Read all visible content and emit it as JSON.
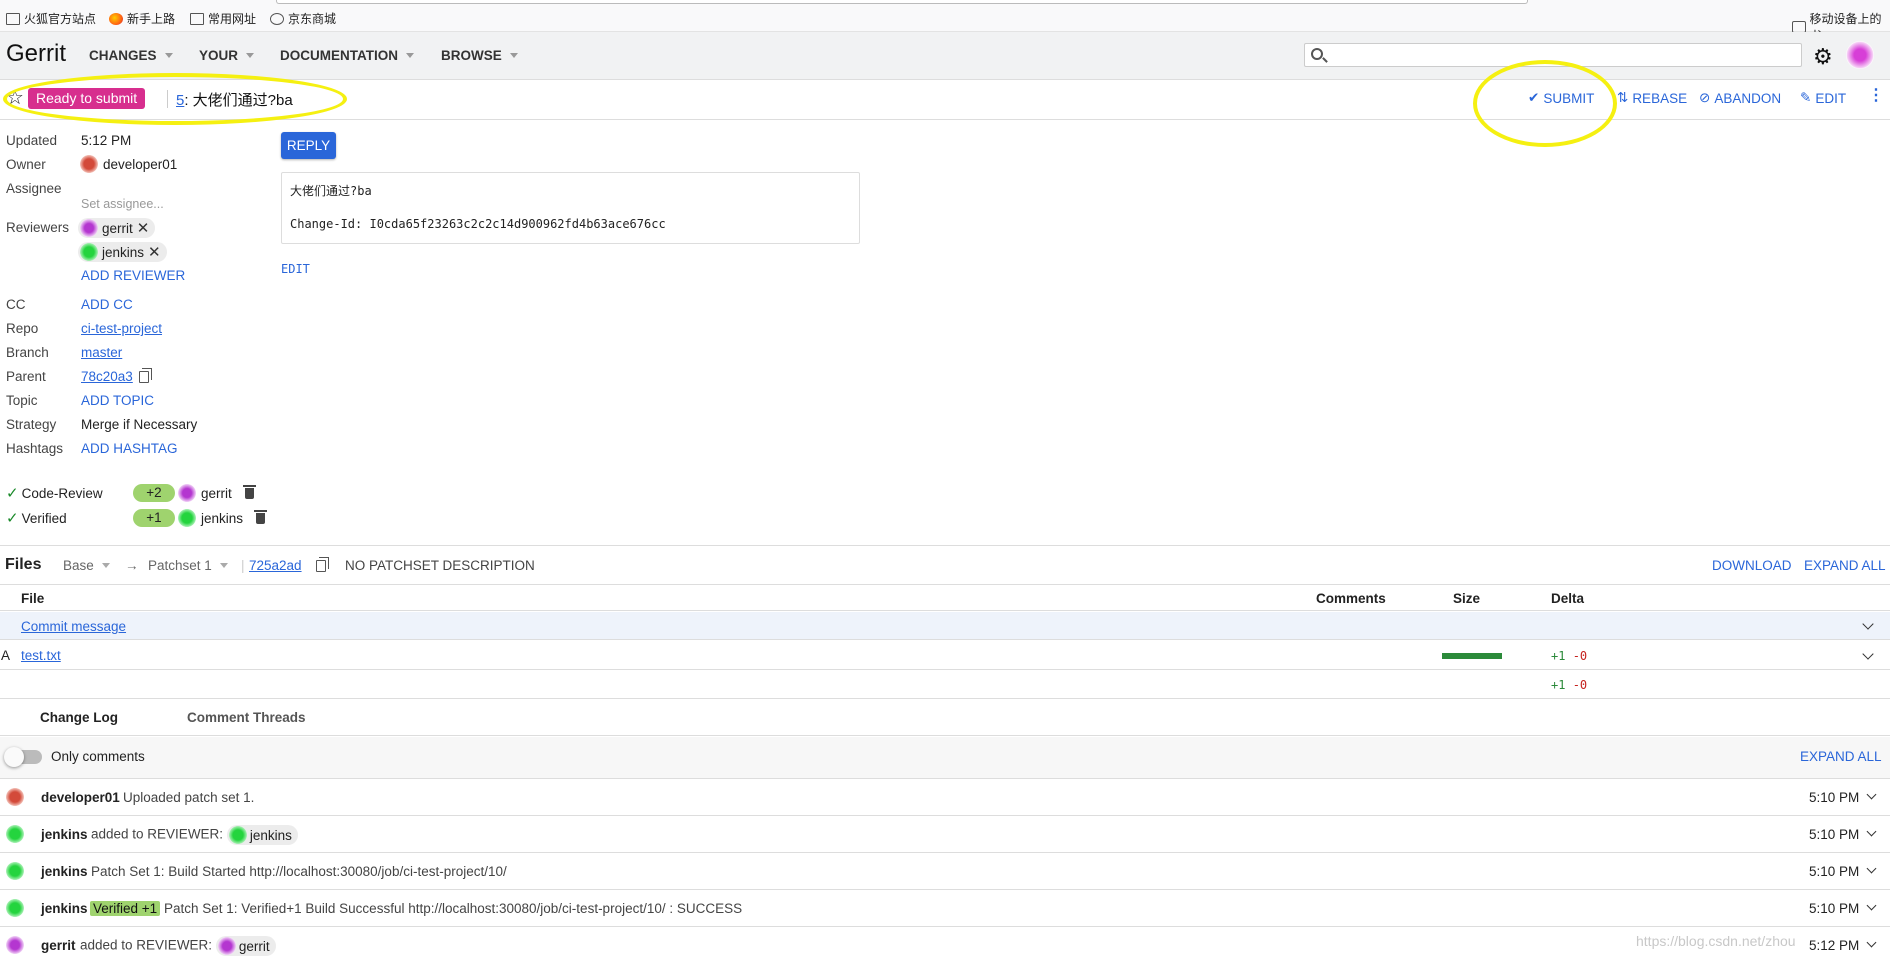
{
  "bookmarks": [
    "火狐官方站点",
    "新手上路",
    "常用网址",
    "京东商城"
  ],
  "bookmarks_right": "移动设备上的书",
  "header": {
    "brand": "Gerrit",
    "menus": [
      "CHANGES",
      "YOUR",
      "DOCUMENTATION",
      "BROWSE"
    ],
    "search_value": ""
  },
  "change": {
    "status": "Ready to submit",
    "number": "5",
    "subject": ": 大佬们通过?ba",
    "actions": [
      "SUBMIT",
      "REBASE",
      "ABANDON",
      "EDIT"
    ]
  },
  "meta": {
    "updated_label": "Updated",
    "updated": "5:12 PM",
    "owner_label": "Owner",
    "owner": "developer01",
    "assignee_label": "Assignee",
    "assignee_placeholder": "Set assignee...",
    "reviewers_label": "Reviewers",
    "reviewers": [
      "gerrit",
      "jenkins"
    ],
    "add_reviewer": "ADD REVIEWER",
    "cc_label": "CC",
    "add_cc": "ADD CC",
    "repo_label": "Repo",
    "repo": "ci-test-project",
    "branch_label": "Branch",
    "branch": "master",
    "parent_label": "Parent",
    "parent": "78c20a3",
    "topic_label": "Topic",
    "add_topic": "ADD TOPIC",
    "strategy_label": "Strategy",
    "strategy": "Merge if Necessary",
    "hashtags_label": "Hashtags",
    "add_hashtag": "ADD HASHTAG"
  },
  "labels": [
    {
      "name": "Code-Review",
      "vote": "+2",
      "voter": "gerrit"
    },
    {
      "name": "Verified",
      "vote": "+1",
      "voter": "jenkins"
    }
  ],
  "commit": {
    "reply": "REPLY",
    "line1": "大佬们通过?ba",
    "line2": "Change-Id: I0cda65f23263c2c2c14d900962fd4b63ace676cc",
    "edit": "EDIT"
  },
  "files": {
    "title": "Files",
    "base": "Base",
    "arrow": "→",
    "patchset": "Patchset 1",
    "commit_hash": "725a2ad",
    "no_desc": "NO PATCHSET DESCRIPTION",
    "download": "DOWNLOAD",
    "expand_all": "EXPAND ALL",
    "columns": [
      "File",
      "Comments",
      "Size",
      "Delta"
    ],
    "rows": [
      {
        "status": "",
        "name": "Commit message"
      },
      {
        "status": "A",
        "name": "test.txt",
        "plus": "+1",
        "minus": "-0",
        "size_fraction": 1.0
      }
    ],
    "total_plus": "+1",
    "total_minus": "-0"
  },
  "tabs": [
    "Change Log",
    "Comment Threads"
  ],
  "only_comments": "Only comments",
  "log_expand_all": "EXPAND ALL",
  "messages": [
    {
      "author": "developer01",
      "text": "Uploaded patch set 1.",
      "time": "5:10 PM"
    },
    {
      "author": "jenkins",
      "text": "added to REVIEWER:",
      "chip": "jenkins",
      "time": "5:10 PM"
    },
    {
      "author": "jenkins",
      "text": "Patch Set 1: Build Started http://localhost:30080/job/ci-test-project/10/",
      "time": "5:10 PM"
    },
    {
      "author": "jenkins",
      "vote_chip": "Verified +1",
      "text": "Patch Set 1: Verified+1 Build Successful http://localhost:30080/job/ci-test-project/10/ : SUCCESS",
      "time": "5:10 PM"
    },
    {
      "author": "gerrit",
      "text": "added to REVIEWER:",
      "chip": "gerrit",
      "time": "5:12 PM"
    }
  ],
  "watermark": "https://blog.csdn.net/zhou",
  "colors": {
    "status": "#d72e8e",
    "link": "#2a66d9",
    "vote": "#9fd36e",
    "annotation": "#f5f011"
  }
}
